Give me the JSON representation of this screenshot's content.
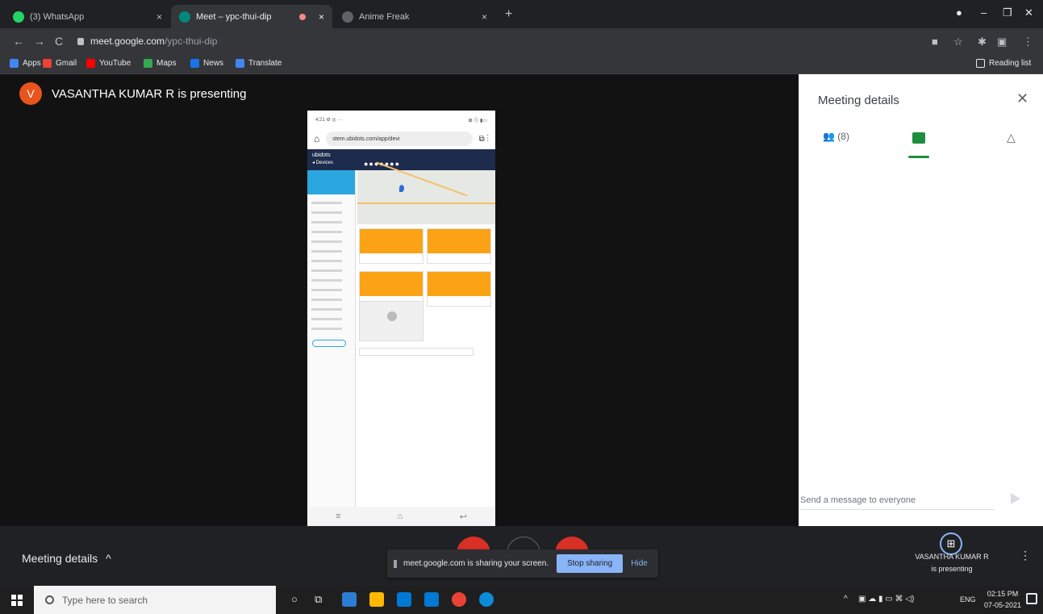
{
  "browser": {
    "tabs": [
      {
        "title": "(3) WhatsApp",
        "active": false
      },
      {
        "title": "Meet – ypc-thui-dip",
        "active": true
      },
      {
        "title": "Anime Freak",
        "active": false
      }
    ],
    "url_host": "meet.google.com",
    "url_path": "/ypc-thui-dip",
    "reading_list": "Reading list"
  },
  "bookmarks": [
    "Apps",
    "Gmail",
    "YouTube",
    "Maps",
    "News",
    "Translate"
  ],
  "meet": {
    "avatar_letter": "V",
    "presenting_text": "VASANTHA KUMAR R is presenting",
    "phone": {
      "status_left": "4:21 ⚙ ◎ ···",
      "status_right": "⊠ ⓢ ▮▭",
      "url": "stem.ubidots.com/app/devi",
      "brand": "ubidots",
      "header_sub": "◂ Devices",
      "header_dots": "●●●●●●●"
    },
    "panel": {
      "title": "Meeting details",
      "people_count": "(8)",
      "message_placeholder": "Send a message to everyone"
    },
    "bottom": {
      "meeting_details": "Meeting details",
      "presenter_name": "VASANTHA KUMAR R",
      "presenter_status": "is presenting"
    },
    "share_bar": {
      "text": "meet.google.com is sharing your screen.",
      "stop": "Stop sharing",
      "hide": "Hide"
    }
  },
  "taskbar": {
    "search_placeholder": "Type here to search",
    "lang": "ENG",
    "time": "02:15 PM",
    "date": "07-05-2021"
  },
  "colors": {
    "meet_bg": "#121212",
    "accent_green": "#1e8e3e",
    "stop_blue": "#8ab4f8",
    "card_orange": "#fba314",
    "avatar_orange": "#e8541c"
  }
}
